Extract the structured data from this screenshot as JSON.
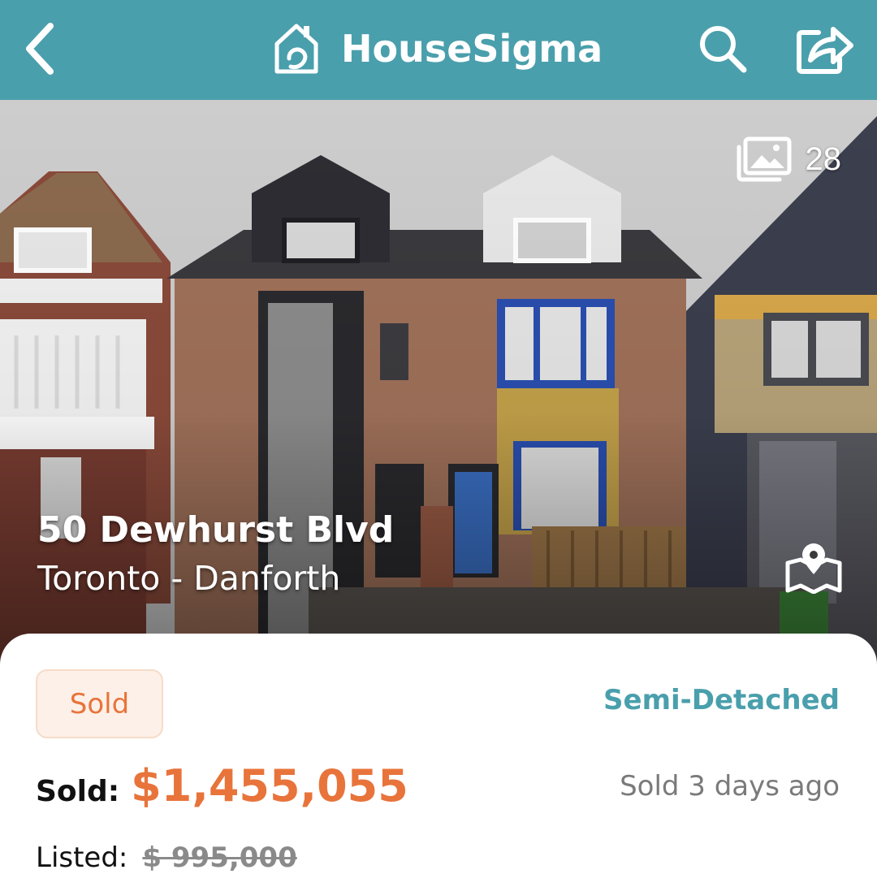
{
  "header": {
    "brand_name": "HouseSigma",
    "back_icon": "chevron-left-icon",
    "logo_icon": "house-swirl-logo-icon",
    "search_icon": "search-icon",
    "share_icon": "share-icon",
    "background_color": "#4a9fac"
  },
  "hero": {
    "photo_count": "28",
    "gallery_icon": "photo-gallery-icon",
    "map_icon": "map-pin-icon",
    "street_address": "50 Dewhurst Blvd",
    "area": "Toronto - Danforth"
  },
  "listing": {
    "status": "Sold",
    "property_type": "Semi-Detached",
    "sold_label": "Sold:",
    "sold_price": "$1,455,055",
    "sold_ago": "Sold 3 days ago",
    "listed_label": "Listed:",
    "listed_price": "$ 995,000",
    "accent_color": "#e8743b",
    "teal_color": "#4a9fac"
  }
}
